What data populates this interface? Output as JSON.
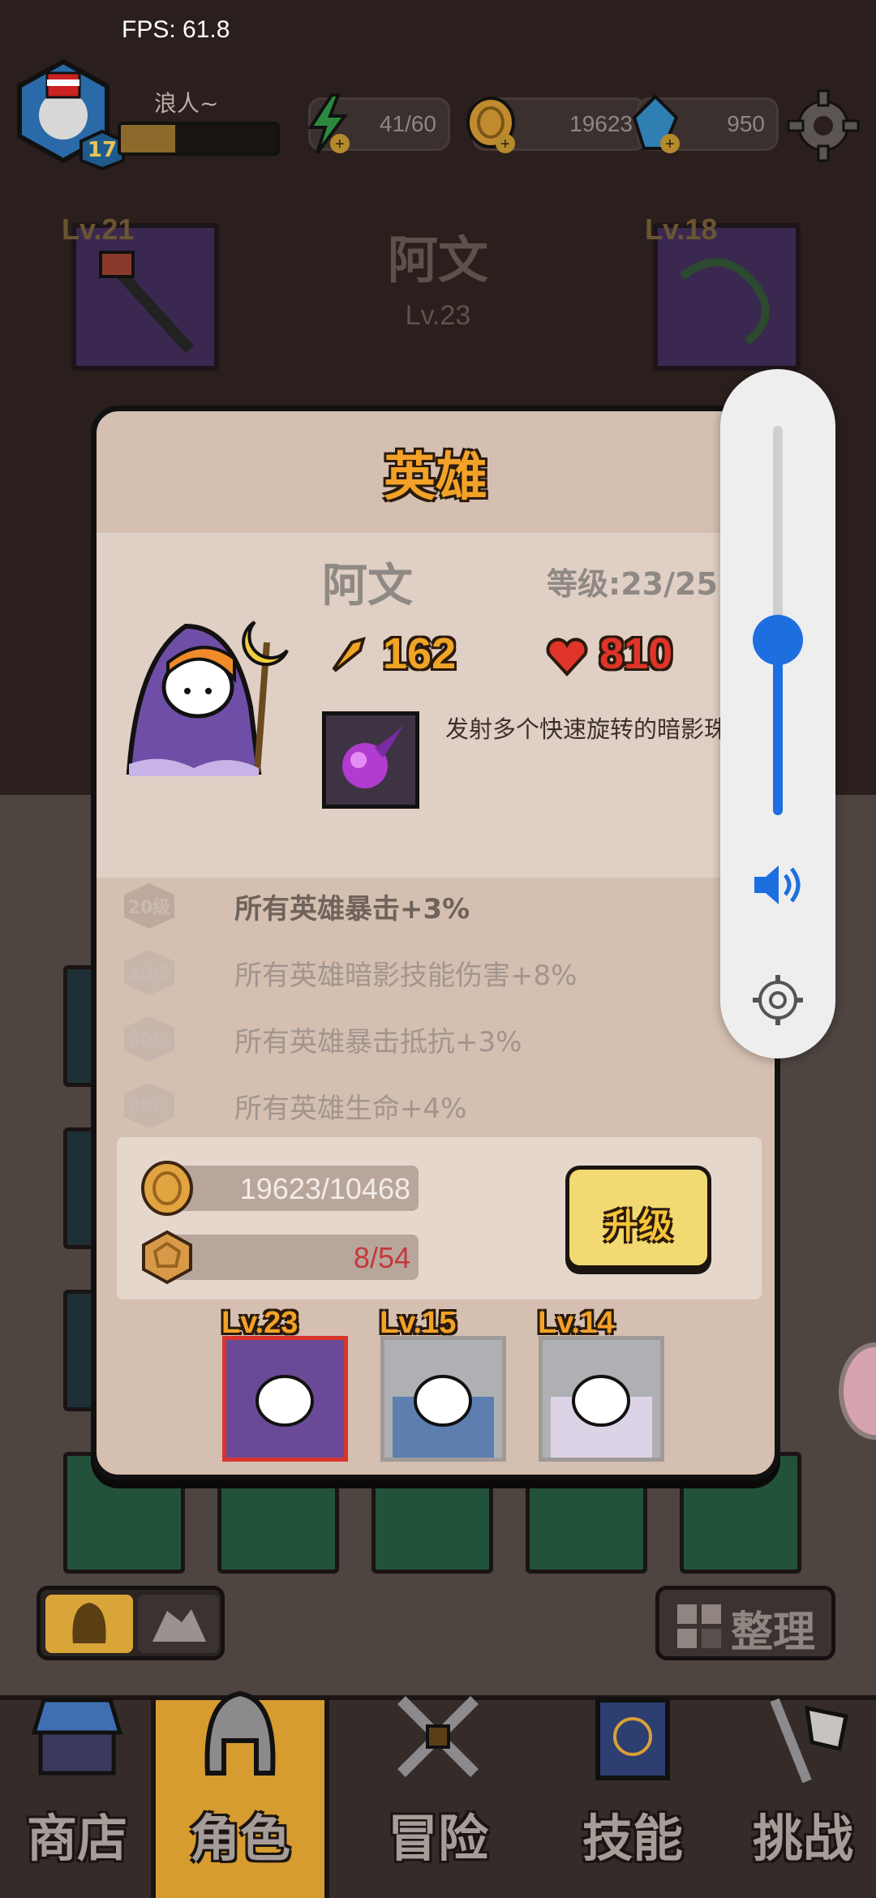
{
  "hud": {
    "fps": "FPS: 61.8",
    "player_name": "浪人~",
    "player_level": "17",
    "energy": "41/60",
    "coins": "19623",
    "gems": "950",
    "xp_fraction": 0.35
  },
  "background": {
    "hero_name": "阿文",
    "hero_level": "Lv.23",
    "equip_left_level": "Lv.21",
    "equip_right_level": "Lv.18"
  },
  "modal": {
    "title": "英雄",
    "hero_name": "阿文",
    "hero_level": "等级:23/25",
    "attack": "162",
    "health": "810",
    "skill_description": "发射多个快速旋转的暗影珠。",
    "bonuses": [
      {
        "badge": "20级",
        "text": "所有英雄暴击+3%",
        "active": true
      },
      {
        "badge": "40级",
        "text": "所有英雄暗影技能伤害+8%",
        "active": false
      },
      {
        "badge": "60级",
        "text": "所有英雄暴击抵抗+3%",
        "active": false
      },
      {
        "badge": "80级",
        "text": "所有英雄生命+4%",
        "active": false
      }
    ],
    "cost_coins": "19623/10468",
    "cost_shards": "8/54",
    "upgrade_label": "升级",
    "heroes": [
      {
        "level": "Lv.23",
        "selected": true
      },
      {
        "level": "Lv.15",
        "selected": false
      },
      {
        "level": "Lv.14",
        "selected": false
      }
    ]
  },
  "volume": {
    "level": 0.45
  },
  "bottom": {
    "sort_label": "整理"
  },
  "nav": {
    "tabs": [
      {
        "label": "商店",
        "icon": "shop-stall-icon"
      },
      {
        "label": "角色",
        "icon": "helmet-icon",
        "active": true
      },
      {
        "label": "冒险",
        "icon": "crossed-swords-icon"
      },
      {
        "label": "技能",
        "icon": "spellbook-icon"
      },
      {
        "label": "挑战",
        "icon": "sword-flag-icon"
      }
    ]
  },
  "colors": {
    "accent_orange": "#f3a227",
    "health_red": "#e0342a",
    "volume_blue": "#1d6fe0",
    "upgrade_yellow": "#f2d971"
  }
}
